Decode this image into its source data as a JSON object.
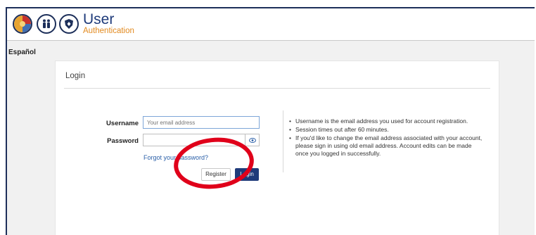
{
  "header": {
    "title": "User",
    "subtitle": "Authentication",
    "logos": [
      "county-seal-icon",
      "family-icon",
      "shield-icon"
    ]
  },
  "language_link": "Español",
  "login": {
    "title": "Login",
    "username_label": "Username",
    "username_placeholder": "Your email address",
    "password_label": "Password",
    "password_placeholder": "",
    "forgot_link": "Forgot your password?",
    "register_label": "Register",
    "login_label": "Login"
  },
  "notes": [
    "Username is the email address you used for account registration.",
    "Session times out after 60 minutes.",
    "If you'd like to change the email address associated with your account, please sign in using old email address. Account edits can be made once you logged in successfully."
  ],
  "colors": {
    "brand_blue": "#1f3b7a",
    "brand_orange": "#e28a1f",
    "annotation_red": "#e0001a"
  }
}
